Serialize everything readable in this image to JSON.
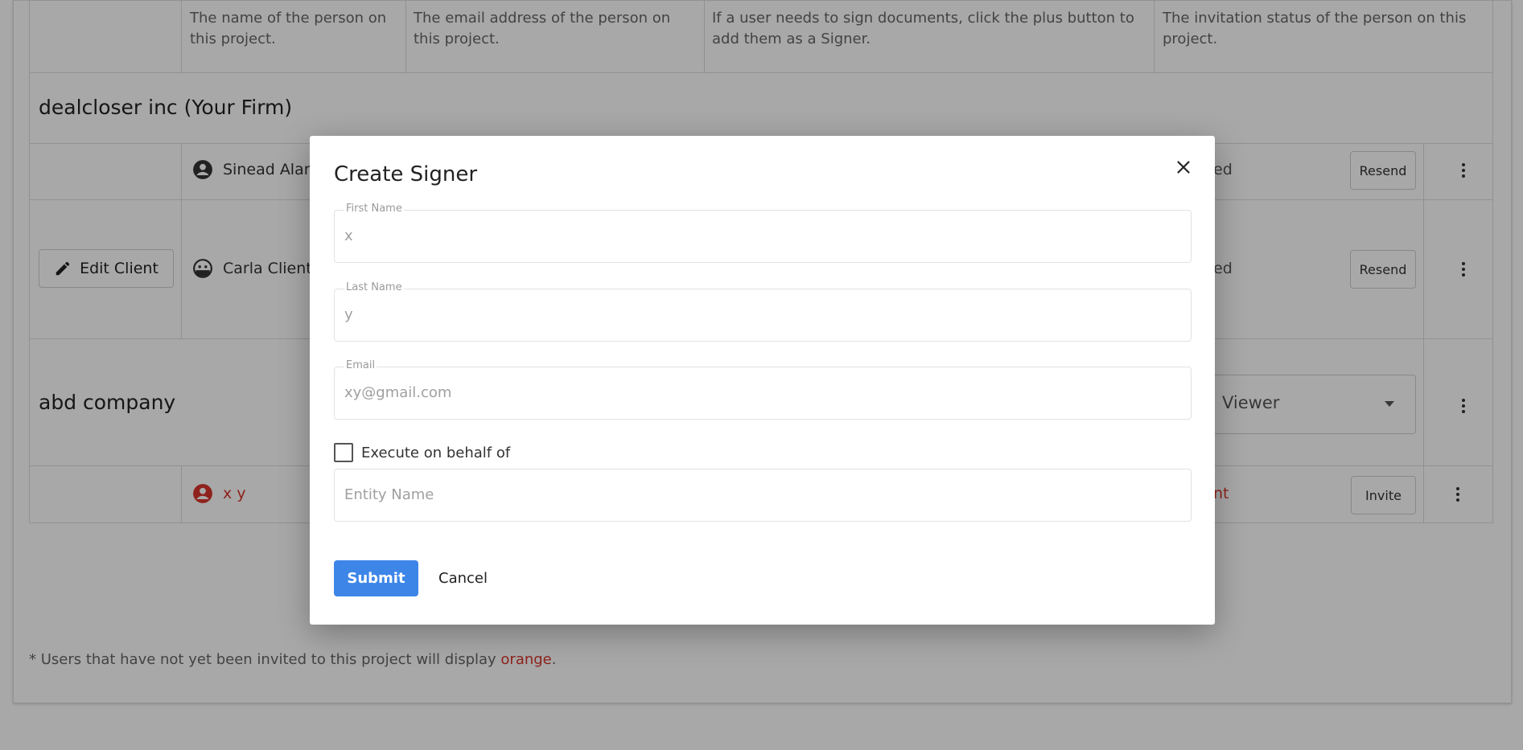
{
  "table": {
    "descriptions": {
      "name": "The name of the person on this project.",
      "email": "The email address of the person on this project.",
      "signer": "If a user needs to sign documents, click the plus button to add them as a Signer.",
      "status": "The invitation status of the person on this project."
    },
    "sections": [
      {
        "title": "dealcloser inc (Your Firm)",
        "people": [
          {
            "name": "Sinead Alari",
            "status_tail": "ed",
            "action": "Resend"
          },
          {
            "name": "Carla Client",
            "status_tail": "ed",
            "action": "Resend",
            "edit_label": "Edit Client"
          }
        ]
      },
      {
        "title": "abd company",
        "role": "Viewer",
        "people": [
          {
            "name": "x y",
            "status_tail": "nt",
            "action": "Invite"
          }
        ]
      }
    ]
  },
  "footnote": {
    "prefix": "* Users that have not yet been invited to this project will display ",
    "highlight": "orange",
    "suffix": "."
  },
  "colors": {
    "accent": "#3d86e8",
    "orange": "#d9342b"
  },
  "modal": {
    "title": "Create Signer",
    "close_icon": "close-icon",
    "first_name": {
      "label": "First Name",
      "value": "x"
    },
    "last_name": {
      "label": "Last Name",
      "value": "y"
    },
    "email": {
      "label": "Email",
      "value": "xy@gmail.com"
    },
    "execute_label": "Execute on behalf of",
    "entity_placeholder": "Entity Name",
    "submit_label": "Submit",
    "cancel_label": "Cancel"
  }
}
